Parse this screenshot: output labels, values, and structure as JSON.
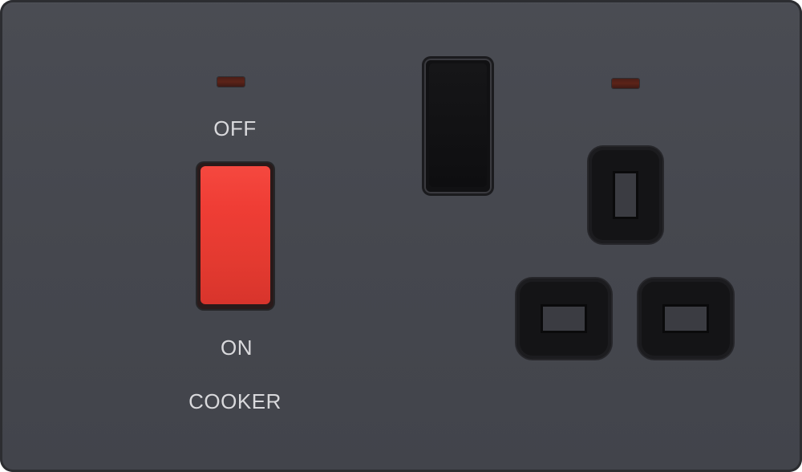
{
  "cooker_switch": {
    "off_label": "OFF",
    "on_label": "ON",
    "name_label": "COOKER",
    "rocker_color": "#e63b32",
    "indicator_color": "#5a2219"
  },
  "socket": {
    "switch_color": "#111113",
    "indicator_color": "#5a2219"
  },
  "plate": {
    "finish_color": "#46484f"
  }
}
